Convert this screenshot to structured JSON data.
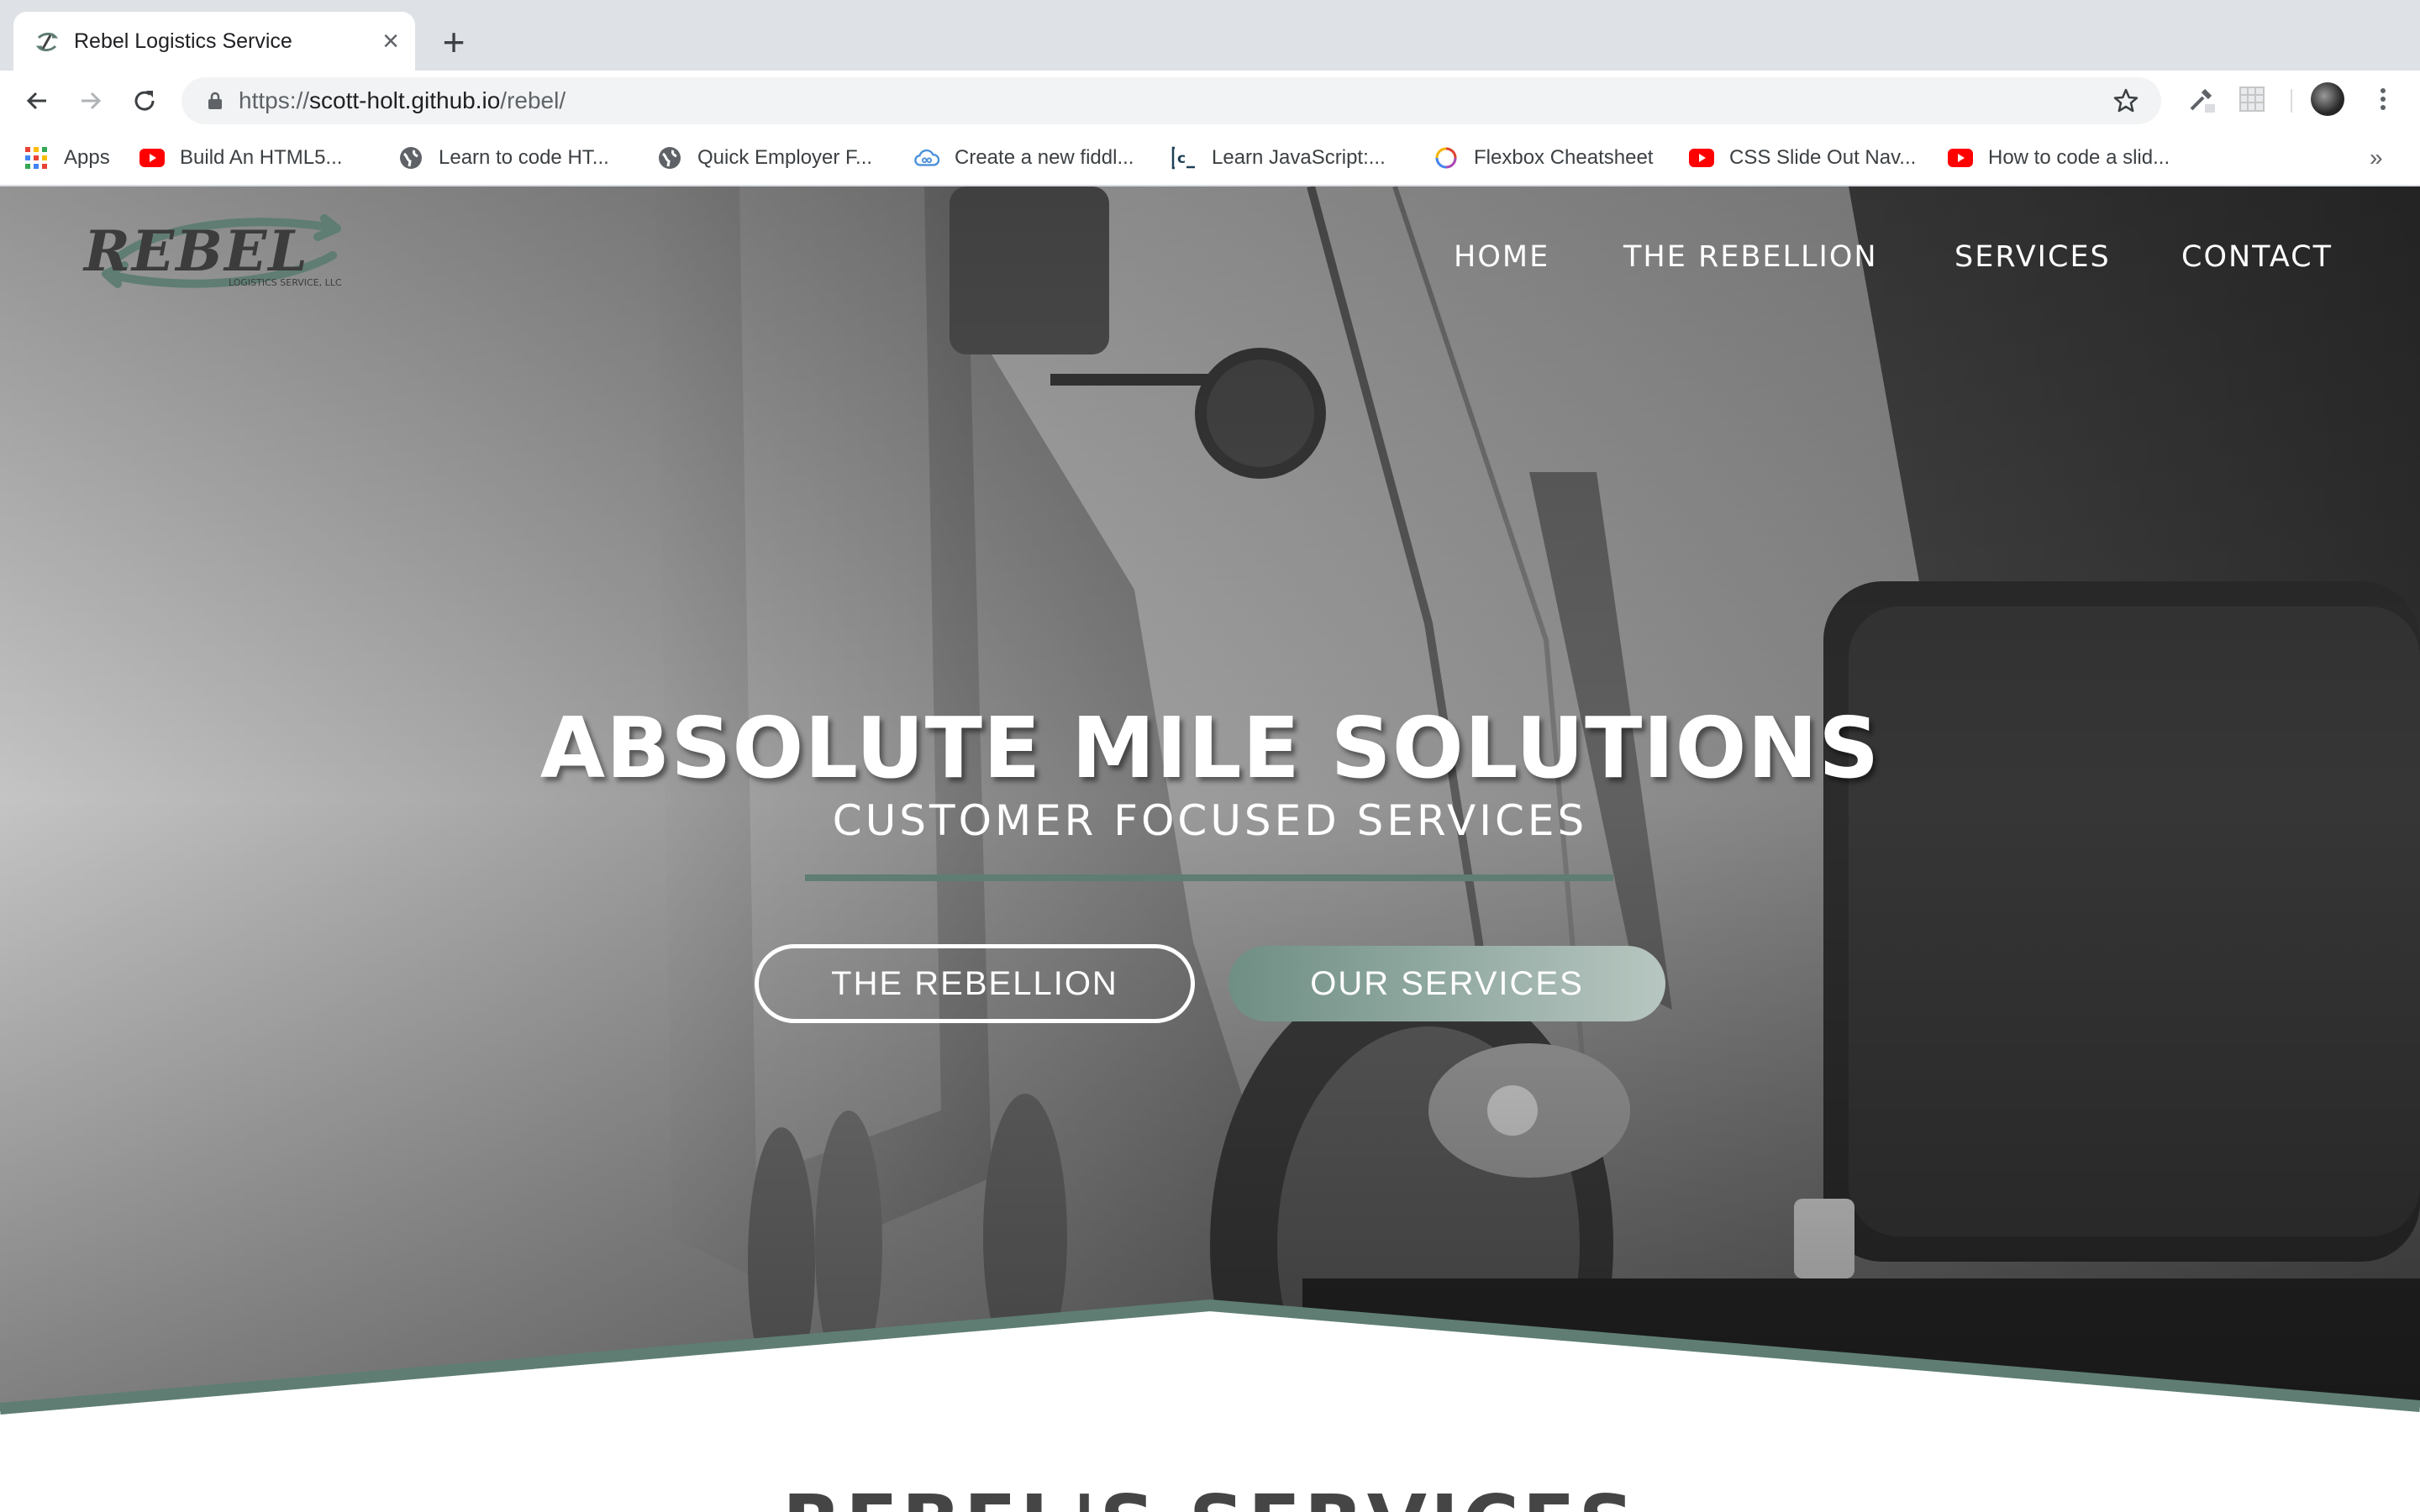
{
  "browser": {
    "tab": {
      "title": "Rebel Logistics Service"
    },
    "url": {
      "scheme": "https://",
      "host": "scott-holt.github.io",
      "path": "/rebel/"
    },
    "bookmarks": [
      {
        "label": "Apps",
        "icon": "apps-grid-icon"
      },
      {
        "label": "Build An HTML5...",
        "icon": "youtube-icon"
      },
      {
        "label": "Learn to code HT...",
        "icon": "globe-icon"
      },
      {
        "label": "Quick Employer F...",
        "icon": "globe-icon"
      },
      {
        "label": "Create a new fiddl...",
        "icon": "cloud-icon"
      },
      {
        "label": "Learn JavaScript:...",
        "icon": "codecademy-icon"
      },
      {
        "label": "Flexbox Cheatsheet",
        "icon": "rainbow-circle-icon"
      },
      {
        "label": "CSS Slide Out Nav...",
        "icon": "youtube-icon"
      },
      {
        "label": "How to code a slid...",
        "icon": "youtube-icon"
      }
    ],
    "more_bookmarks": "»"
  },
  "site": {
    "logo": {
      "wordmark": "REBEL",
      "tagline": "LOGISTICS SERVICE, LLC"
    },
    "nav": [
      "HOME",
      "THE REBELLION",
      "SERVICES",
      "CONTACT"
    ],
    "hero": {
      "headline": "ABSOLUTE MILE SOLUTIONS",
      "subhead": "CUSTOMER FOCUSED SERVICES",
      "primary_button": "THE REBELLION",
      "secondary_button": "OUR SERVICES"
    },
    "section_title": "REBEL'S SERVICES"
  },
  "colors": {
    "brand_green": "#5f7d73",
    "button_gradient_start": "#6f8e84",
    "button_gradient_end": "#b7c6c0"
  }
}
